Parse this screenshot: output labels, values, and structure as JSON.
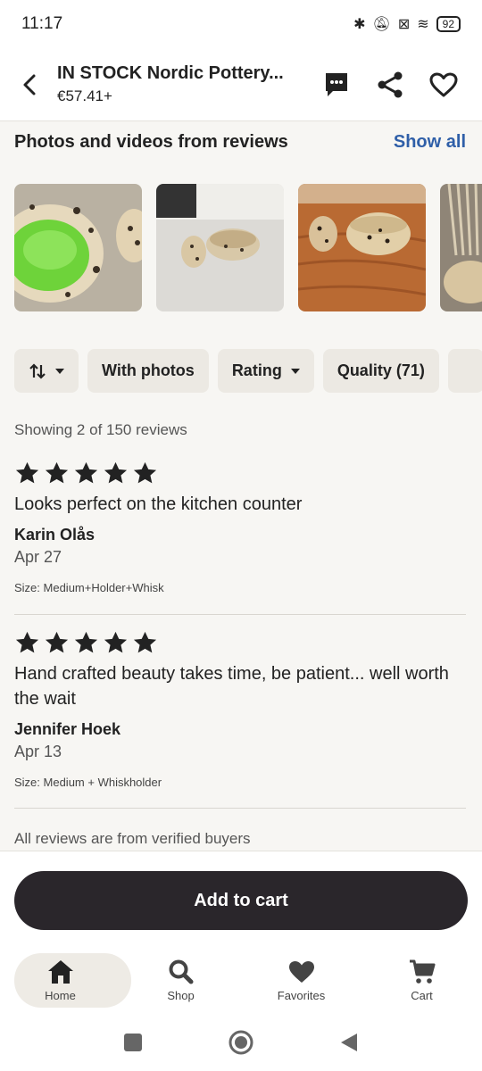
{
  "status": {
    "time": "11:17",
    "battery": "92"
  },
  "header": {
    "title": "IN STOCK Nordic Pottery...",
    "price": "€57.41+"
  },
  "photos_section": {
    "title": "Photos and videos from reviews",
    "show_all": "Show all"
  },
  "filters": {
    "with_photos": "With photos",
    "rating": "Rating",
    "quality": "Quality (71)"
  },
  "showing": "Showing 2 of 150 reviews",
  "reviews": [
    {
      "rating": 5,
      "text": "Looks perfect on the kitchen counter",
      "name": "Karin Olås",
      "date": "Apr 27",
      "size": "Size: Medium+Holder+Whisk"
    },
    {
      "rating": 5,
      "text": "Hand crafted beauty takes time, be patient... well worth the wait",
      "name": "Jennifer Hoek",
      "date": "Apr 13",
      "size": "Size: Medium + Whiskholder"
    }
  ],
  "verified_note": "All reviews are from verified buyers",
  "add_to_cart": "Add to cart",
  "nav": {
    "home": "Home",
    "shop": "Shop",
    "favorites": "Favorites",
    "cart": "Cart"
  }
}
